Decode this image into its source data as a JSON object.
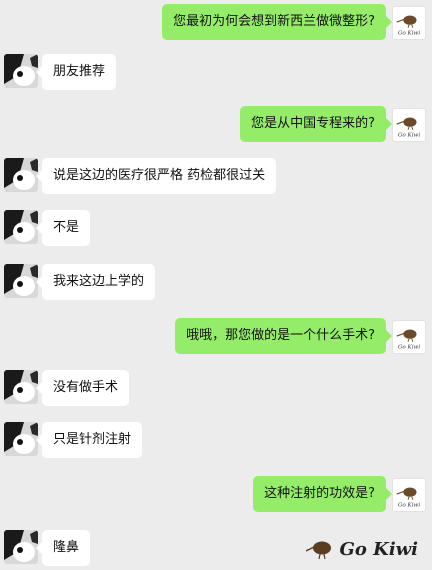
{
  "chat": {
    "messages": [
      {
        "side": "right",
        "text": "您最初为何会想到新西兰做微整形?"
      },
      {
        "side": "left",
        "text": "朋友推荐"
      },
      {
        "side": "right",
        "text": "您是从中国专程来的?"
      },
      {
        "side": "left",
        "text": "说是这边的医疗很严格 药检都很过关"
      },
      {
        "side": "left",
        "text": "不是"
      },
      {
        "side": "left",
        "text": "我来这边上学的"
      },
      {
        "side": "right",
        "text": "哦哦，那您做的是一个什么手术?"
      },
      {
        "side": "left",
        "text": "没有做手术"
      },
      {
        "side": "left",
        "text": "只是针剂注射"
      },
      {
        "side": "right",
        "text": "这种注射的功效是?"
      },
      {
        "side": "left",
        "text": "隆鼻"
      }
    ]
  },
  "brand": {
    "avatar_label": "Go Kiwi",
    "watermark": "Go Kiwi"
  },
  "colors": {
    "background": "#ececec",
    "outgoing_bubble": "#95ec69",
    "incoming_bubble": "#ffffff"
  },
  "icons": {
    "user_avatar": "dog-avatar-icon",
    "brand_avatar": "kiwi-bird-icon"
  }
}
